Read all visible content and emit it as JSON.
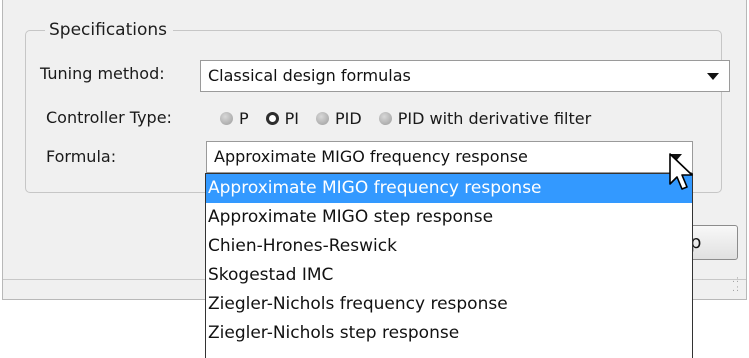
{
  "specifications": {
    "group_title": "Specifications",
    "tuning_method": {
      "label": "Tuning method:",
      "value": "Classical design formulas"
    },
    "controller_type": {
      "label": "Controller Type:",
      "options": [
        {
          "label": "P",
          "selected": false
        },
        {
          "label": "PI",
          "selected": true
        },
        {
          "label": "PID",
          "selected": false
        },
        {
          "label": "PID with derivative filter",
          "selected": false
        }
      ]
    },
    "formula": {
      "label": "Formula:",
      "value": "Approximate MIGO frequency response",
      "options": [
        {
          "label": "Approximate MIGO frequency response",
          "highlighted": true
        },
        {
          "label": "Approximate MIGO step response",
          "highlighted": false
        },
        {
          "label": "Chien-Hrones-Reswick",
          "highlighted": false
        },
        {
          "label": "Skogestad IMC",
          "highlighted": false
        },
        {
          "label": "Ziegler-Nichols frequency response",
          "highlighted": false
        },
        {
          "label": "Ziegler-Nichols step response",
          "highlighted": false
        }
      ]
    }
  },
  "side_button": {
    "label": "p"
  },
  "colors": {
    "highlight": "#3399ff",
    "dialog_background": "#f0f0f0"
  },
  "cursor_icon": "arrow-cursor-icon"
}
